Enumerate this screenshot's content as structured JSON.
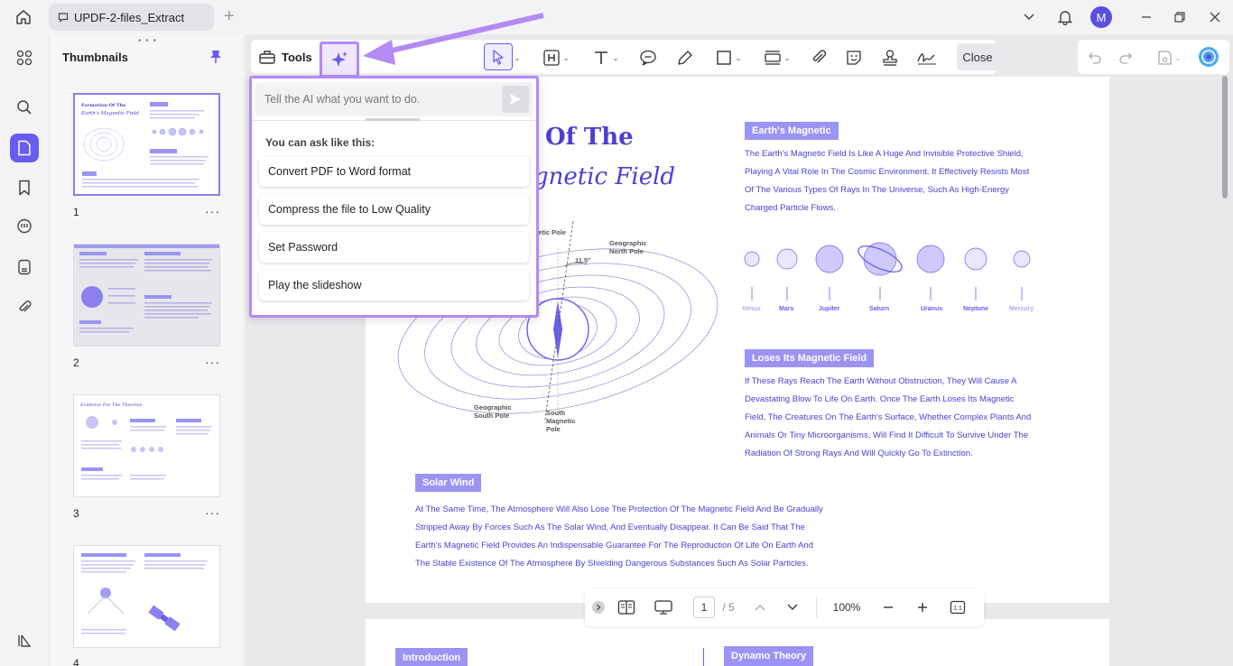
{
  "titlebar": {
    "tab_title": "UPDF-2-files_Extract",
    "avatar_letter": "M"
  },
  "thumbnails": {
    "title": "Thumbnails",
    "handle": "• • •",
    "pages": [
      {
        "num": "1",
        "heading": "Formation Of The Earth's Magnetic Field"
      },
      {
        "num": "2",
        "heading": ""
      },
      {
        "num": "3",
        "heading": "Evidence For The Theories"
      },
      {
        "num": "4",
        "heading": ""
      }
    ],
    "more": "···"
  },
  "toolbar": {
    "tools_label": "Tools",
    "close_label": "Close"
  },
  "ai_panel": {
    "placeholder": "Tell the AI what you want to do.",
    "hint": "You can ask like this:",
    "suggestions": [
      "Convert PDF to Word format",
      "Compress the file to Low Quality",
      "Set Password",
      "Play the slideshow"
    ]
  },
  "document": {
    "heading_line1": "Of The",
    "heading_line2": "gnetic Field",
    "earths_magnetic_label": "Earth's Magnetic",
    "earths_magnetic_text": [
      "The Earth's Magnetic Field Is Like A Huge And Invisible Protective Shield,",
      "Playing A Vital Role In The Cosmic Environment. It Effectively Resists Most",
      "Of The Various Types Of Rays In The Universe, Such As High-Energy",
      "Charged Particle Flows."
    ],
    "planets": [
      "Venus",
      "Mars",
      "Jupiter",
      "Saturn",
      "Uranus",
      "Neptune",
      "Mercury"
    ],
    "loses_label": "Loses Its Magnetic Field",
    "loses_text": [
      "If These Rays Reach The Earth Without Obstruction, They Will Cause A",
      "Devastating Blow To Life On Earth. Once The Earth Loses Its Magnetic",
      "Field, The Creatures On The Earth's Surface, Whether Complex Plants And",
      "Animals Or Tiny Microorganisms, Will Find It Difficult To Survive Under The",
      "Radiation Of Strong Rays And Will Quickly Go To Extinction."
    ],
    "diagram": {
      "geo_north": "Geographic\nNorth Pole",
      "mag_pole_top": "gnetic Pole",
      "angle": "11.5°",
      "geo_south": "Geographic\nSouth Pole",
      "south_mag": "South\nMagnetic\nPole"
    },
    "solar_label": "Solar Wind",
    "solar_text": [
      "At The Same Time, The Atmosphere Will Also Lose The Protection Of The Magnetic Field And Be Gradually",
      "Stripped Away By Forces Such As The Solar Wind, And Eventually Disappear. It Can Be Said That The",
      "Earth's Magnetic Field Provides An Indispensable Guarantee For The Reproduction Of Life On Earth And",
      "The Stable Existence Of The Atmosphere By Shielding Dangerous Substances Such As Solar Particles."
    ],
    "page2_intro": "Introduction",
    "page2_dynamo": "Dynamo Theory"
  },
  "bottom_bar": {
    "page_current": "1",
    "page_total": "/ 5",
    "zoom": "100%"
  },
  "colors": {
    "accent": "#6a5cf0",
    "highlight": "#b48af5",
    "doc_text": "#4b3fd0"
  }
}
